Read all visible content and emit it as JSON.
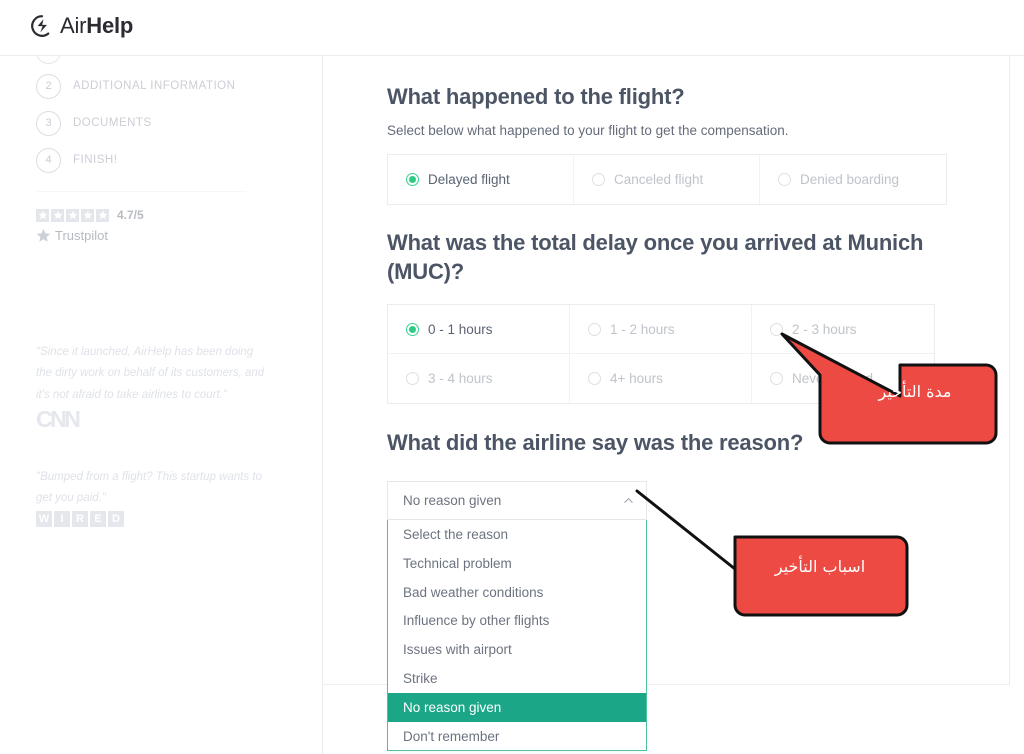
{
  "header": {
    "logo_light": "Air",
    "logo_bold": "Help",
    "logo_icon": "airhelp-logo-icon"
  },
  "sidebar": {
    "steps": [
      {
        "num": "2",
        "label": "ADDITIONAL INFORMATION"
      },
      {
        "num": "3",
        "label": "DOCUMENTS"
      },
      {
        "num": "4",
        "label": "FINISH!"
      }
    ],
    "trustpilot": {
      "score": "4.7/5",
      "name": "Trustpilot",
      "stars": 5
    },
    "press": [
      {
        "quote": "\"Since it launched, AirHelp has been doing the dirty work on behalf of its customers, and it's not afraid to take airlines to court.\"",
        "logo": "CNN"
      },
      {
        "quote": "\"Bumped from a flight? This startup wants to get you paid.\"",
        "logo": "WIRED"
      }
    ],
    "wired_letters": [
      "W",
      "I",
      "R",
      "E",
      "D"
    ]
  },
  "main": {
    "section_flight": {
      "title": "What happened to the flight?",
      "subtitle": "Select below what happened to your flight to get the compensation.",
      "options": [
        {
          "label": "Delayed flight",
          "selected": true
        },
        {
          "label": "Canceled flight",
          "selected": false
        },
        {
          "label": "Denied boarding",
          "selected": false
        }
      ]
    },
    "section_delay": {
      "title": "What was the total delay once you arrived at Munich (MUC)?",
      "options": [
        {
          "label": "0 - 1 hours",
          "selected": true
        },
        {
          "label": "1 - 2 hours",
          "selected": false
        },
        {
          "label": "2 - 3 hours",
          "selected": false
        },
        {
          "label": "3 - 4 hours",
          "selected": false
        },
        {
          "label": "4+ hours",
          "selected": false
        },
        {
          "label": "Never arrived",
          "selected": false
        }
      ]
    },
    "section_reason": {
      "title": "What did the airline say was the reason?",
      "select_value": "No reason given",
      "chevron": "chevron-up-icon",
      "options": [
        {
          "label": "Select the reason",
          "active": false
        },
        {
          "label": "Technical problem",
          "active": false
        },
        {
          "label": "Bad weather conditions",
          "active": false
        },
        {
          "label": "Influence by other flights",
          "active": false
        },
        {
          "label": "Issues with airport",
          "active": false
        },
        {
          "label": "Strike",
          "active": false
        },
        {
          "label": "No reason given",
          "active": true
        },
        {
          "label": "Don't remember",
          "active": false
        }
      ]
    }
  },
  "callouts": [
    {
      "text": "مدة التأخير",
      "color": "#ef4444"
    },
    {
      "text": "اسباب التأخير",
      "color": "#ef4444"
    }
  ],
  "colors": {
    "accent_green": "#2ecb87",
    "accent_teal": "#1ba787",
    "dropdown_border": "#4fc0a0",
    "callout_red": "#ef4444",
    "heading": "#4c5565",
    "muted": "#bfc3cb"
  }
}
